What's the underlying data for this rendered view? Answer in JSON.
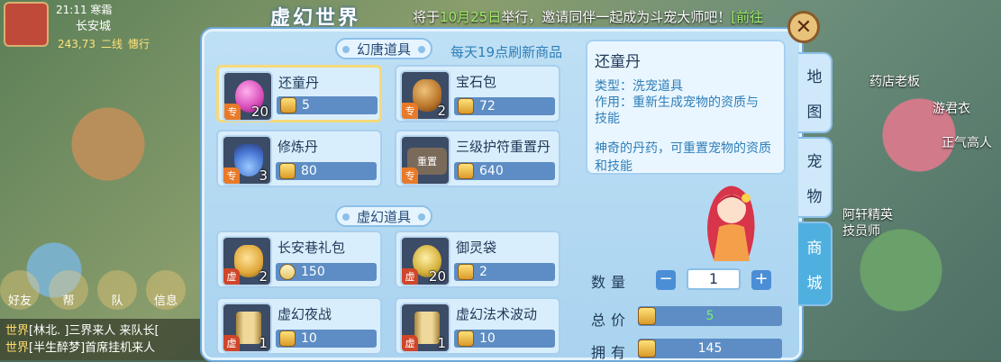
{
  "hud": {
    "time": "21:11",
    "weather": "寒霜",
    "city": "长安城",
    "coord_x": "243,73",
    "line": "二线",
    "mode": "憓行"
  },
  "banner": {
    "logo": "虚幻世界",
    "msg_prefix": "将于",
    "msg_date": "10月25日",
    "msg_suffix": "举行，邀请同伴一起成为斗宠大师吧！",
    "msg_link": "[前往"
  },
  "chat": {
    "line1_channel": "世界",
    "line1_text": "[林北. ]三界来人 来队长[",
    "line2_channel": "世界",
    "line2_text": "[半生醉梦]首席挂机来人"
  },
  "chat_buttons": [
    "好友",
    "帮",
    "队",
    "信息"
  ],
  "shop": {
    "section1_label": "幻唐道具",
    "refresh_note": "每天19点刷新商品",
    "section2_label": "虚幻道具",
    "items_row1": [
      {
        "name": "还童丹",
        "qty": "20",
        "tag": "专",
        "price": "5",
        "art": "#d64ab8"
      },
      {
        "name": "宝石包",
        "qty": "2",
        "tag": "专",
        "price": "72",
        "art": "#b8742a"
      }
    ],
    "items_row2": [
      {
        "name": "修炼丹",
        "qty": "3",
        "tag": "专",
        "price": "80",
        "art": "#4a7ad6"
      },
      {
        "name": "三级护符重置丹",
        "qty": "",
        "tag": "专",
        "price": "640",
        "art": "#7a6a5a",
        "art_label": "重置"
      }
    ],
    "items_row3": [
      {
        "name": "长安巷礼包",
        "qty": "2",
        "tag": "虚",
        "price": "150",
        "art": "#e0a83a"
      },
      {
        "name": "御灵袋",
        "qty": "20",
        "tag": "虚",
        "price": "2",
        "art": "#d4b03a"
      }
    ],
    "items_row4": [
      {
        "name": "虚幻夜战",
        "qty": "1",
        "tag": "虚",
        "price": "10",
        "art": "#e0c27a"
      },
      {
        "name": "虚幻法术波动",
        "qty": "1",
        "tag": "虚",
        "price": "10",
        "art": "#e0c27a"
      }
    ]
  },
  "detail": {
    "title": "还童丹",
    "type_line": "类型：洗宠道具",
    "effect_line1": "作用：重新生成宠物的资质与",
    "effect_line2": "技能",
    "desc": "神奇的丹药，可重置宠物的资质和技能"
  },
  "purchase": {
    "qty_label": "数量",
    "qty_value": "1",
    "total_label": "总价",
    "total_value": "5",
    "own_label": "拥有",
    "own_value": "145",
    "minus": "−",
    "plus": "+"
  },
  "side_tabs": [
    {
      "label1": "地",
      "label2": "图",
      "active": false
    },
    {
      "label1": "宠",
      "label2": "物",
      "active": false
    },
    {
      "label1": "商",
      "label2": "城",
      "active": true
    }
  ],
  "close_glyph": "✕",
  "right_hud": {
    "t1": "药店老板",
    "t2": "游君衣",
    "t3": "正气高人",
    "t4": "阿轩精英",
    "t5": "技员师"
  }
}
